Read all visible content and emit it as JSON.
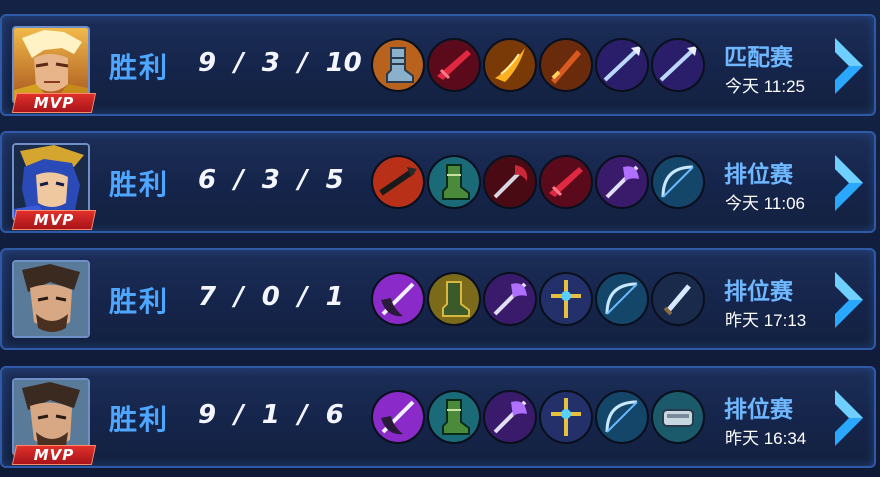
{
  "matches": [
    {
      "hero": "hero-golden-warrior",
      "mvp": true,
      "mvp_label": "MVP",
      "result": "胜利",
      "kills": "9",
      "deaths": "3",
      "assists": "10",
      "items": [
        "armored-boots",
        "crimson-blade",
        "flame-fang",
        "fire-sword",
        "frost-spear",
        "frost-spear"
      ],
      "mode": "匹配赛",
      "time": "今天 11:25"
    },
    {
      "hero": "hero-blue-haired-warrior",
      "mvp": true,
      "mvp_label": "MVP",
      "result": "胜利",
      "kills": "6",
      "deaths": "3",
      "assists": "5",
      "items": [
        "flame-spear",
        "emerald-boots",
        "shadow-axe",
        "crimson-blade",
        "violet-battleaxe",
        "azure-bow"
      ],
      "mode": "排位赛",
      "time": "今天 11:06"
    },
    {
      "hero": "hero-bearded-warrior",
      "mvp": false,
      "mvp_label": "",
      "result": "胜利",
      "kills": "7",
      "deaths": "0",
      "assists": "1",
      "items": [
        "purple-war-axe",
        "golden-boots",
        "violet-battleaxe",
        "golden-cross-staff",
        "azure-bow",
        "ice-dagger"
      ],
      "mode": "排位赛",
      "time": "昨天 17:13"
    },
    {
      "hero": "hero-bearded-warrior",
      "mvp": true,
      "mvp_label": "MVP",
      "result": "胜利",
      "kills": "9",
      "deaths": "1",
      "assists": "6",
      "items": [
        "purple-war-axe",
        "emerald-boots",
        "violet-battleaxe",
        "golden-cross-staff",
        "azure-bow",
        "steel-bracer"
      ],
      "mode": "排位赛",
      "time": "昨天 16:34"
    }
  ],
  "colors": {
    "accent": "#4fa6ff",
    "mode_text": "#6fb8ff",
    "mvp_red": "#d42a26",
    "row_border": "#2f5aa8"
  },
  "icons": {
    "detail_arrow": "chevron-right-icon"
  }
}
